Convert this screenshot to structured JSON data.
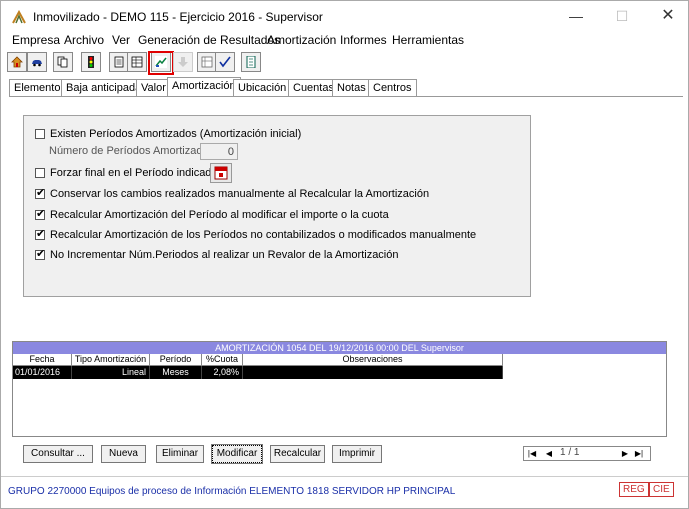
{
  "window": {
    "title": "Inmovilizado - DEMO 115 - Ejercicio 2016 - Supervisor",
    "min_symbol": "—",
    "max_symbol": "☐",
    "close_symbol": "✕"
  },
  "menu": [
    "Empresa",
    "Archivo",
    "Ver",
    "Generación de Resultados",
    "Amortización",
    "Informes",
    "Herramientas"
  ],
  "toolbar": {
    "icons": [
      "home-icon",
      "car-icon",
      "copy-icon",
      "traffic-light-icon",
      "document-icon",
      "table-icon",
      "chart-icon",
      "down-arrow-icon",
      "grid-icon",
      "check-icon",
      "list-icon"
    ]
  },
  "tabs": [
    "Elemento",
    "Baja anticipada",
    "Valor",
    "Amortización",
    "Ubicación",
    "Cuentas",
    "Notas",
    "Centros"
  ],
  "form": {
    "existen_periodos": "Existen Períodos Amortizados (Amortización inicial)",
    "numero_periodos_label": "Número de Períodos Amortizados",
    "numero_periodos_value": "0",
    "forzar_final": "Forzar final en el Período indicado",
    "conservar": "Conservar los cambios realizados manualmente al Recalcular la Amortización",
    "recalcular_periodo": "Recalcular Amortización del Período al modificar el importe o la cuota",
    "recalcular_no_contab": "Recalcular Amortización de los Períodos no contabilizados o modificados manualmente",
    "no_incrementar": "No Incrementar Núm.Periodos al realizar un Revalor de la Amortización"
  },
  "grid": {
    "title": "AMORTIZACIÓN 1054 DEL 19/12/2016 00:00 DEL Supervisor",
    "headers": [
      "Fecha",
      "Tipo Amortización",
      "Período",
      "%Cuota",
      "Observaciones"
    ],
    "rows": [
      [
        "01/01/2016",
        "Lineal",
        "Meses",
        "2,08%",
        ""
      ]
    ]
  },
  "buttons": {
    "consultar": "Consultar ...",
    "nueva": "Nueva",
    "eliminar": "Eliminar",
    "modificar": "Modificar",
    "recalcular": "Recalcular",
    "imprimir": "Imprimir"
  },
  "navigator": {
    "position": "1 / 1",
    "first": "|◀",
    "prev": "◀",
    "next": "▶",
    "last": "▶|"
  },
  "status": {
    "text": "GRUPO 2270000 Equipos de proceso de Información ELEMENTO 1818 SERVIDOR HP PRINCIPAL",
    "reg": "REG",
    "cie": "CIE"
  }
}
